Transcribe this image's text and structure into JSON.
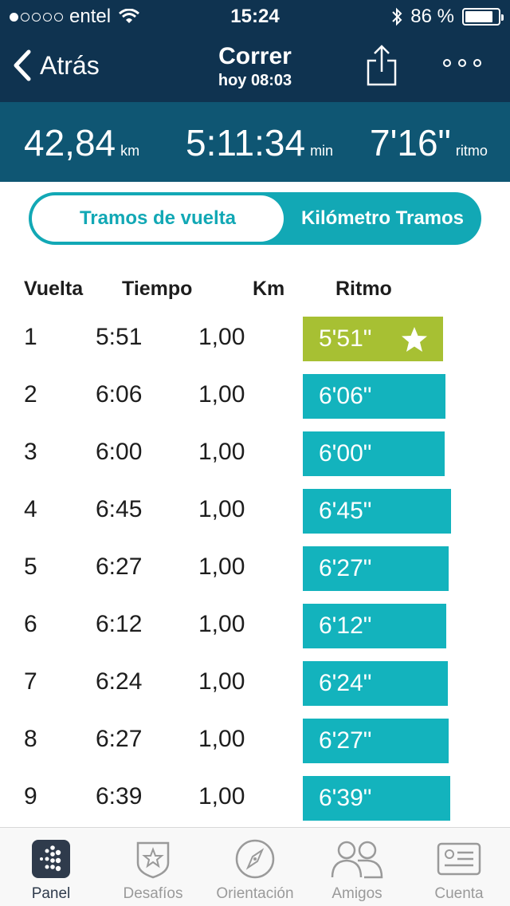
{
  "status_bar": {
    "carrier": "entel",
    "time": "15:24",
    "battery_text": "86 %",
    "battery_level": 0.86
  },
  "nav": {
    "back_label": "Atrás",
    "title": "Correr",
    "subtitle": "hoy 08:03"
  },
  "summary": {
    "distance_value": "42,84",
    "distance_unit": "km",
    "duration_value": "5:11:34",
    "duration_unit": "min",
    "pace_value": "7'16\"",
    "pace_unit": "ritmo"
  },
  "segmented": {
    "active_label": "Tramos de vuelta",
    "inactive_label": "Kilómetro Tramos"
  },
  "table": {
    "headers": {
      "lap": "Vuelta",
      "time": "Tiempo",
      "km": "Km",
      "pace": "Ritmo"
    },
    "rows": [
      {
        "lap": "1",
        "time": "5:51",
        "km": "1,00",
        "pace": "5'51\"",
        "best": true
      },
      {
        "lap": "2",
        "time": "6:06",
        "km": "1,00",
        "pace": "6'06\"",
        "best": false
      },
      {
        "lap": "3",
        "time": "6:00",
        "km": "1,00",
        "pace": "6'00\"",
        "best": false
      },
      {
        "lap": "4",
        "time": "6:45",
        "km": "1,00",
        "pace": "6'45\"",
        "best": false
      },
      {
        "lap": "5",
        "time": "6:27",
        "km": "1,00",
        "pace": "6'27\"",
        "best": false
      },
      {
        "lap": "6",
        "time": "6:12",
        "km": "1,00",
        "pace": "6'12\"",
        "best": false
      },
      {
        "lap": "7",
        "time": "6:24",
        "km": "1,00",
        "pace": "6'24\"",
        "best": false
      },
      {
        "lap": "8",
        "time": "6:27",
        "km": "1,00",
        "pace": "6'27\"",
        "best": false
      },
      {
        "lap": "9",
        "time": "6:39",
        "km": "1,00",
        "pace": "6'39\"",
        "best": false
      }
    ]
  },
  "tabbar": {
    "items": [
      {
        "label": "Panel",
        "icon": "dots-grid-icon",
        "active": true
      },
      {
        "label": "Desafíos",
        "icon": "star-badge-icon",
        "active": false
      },
      {
        "label": "Orientación",
        "icon": "compass-icon",
        "active": false
      },
      {
        "label": "Amigos",
        "icon": "friends-icon",
        "active": false
      },
      {
        "label": "Cuenta",
        "icon": "id-card-icon",
        "active": false
      }
    ]
  },
  "colors": {
    "header_bg": "#0f3350",
    "summary_bg": "#0f5673",
    "accent_teal": "#13b3bd",
    "best_green": "#a7c033"
  }
}
